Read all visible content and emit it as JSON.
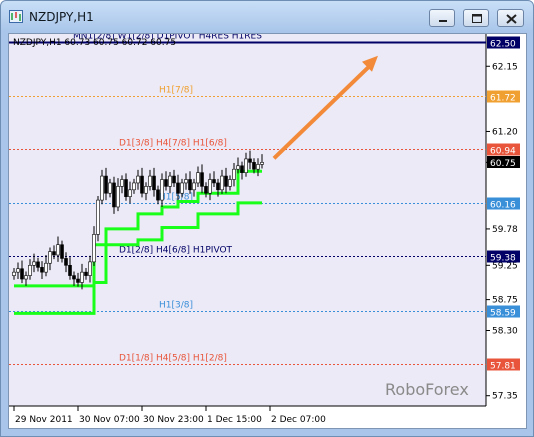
{
  "window": {
    "title": "NZDJPY,H1",
    "buttons": {
      "minimize": "minimize-icon",
      "maximize": "maximize-icon",
      "close": "close-icon"
    }
  },
  "chart_header": "NZDJPY,H1  60.73 60.75 60.72 60.75",
  "watermark": "RoboForex",
  "colors": {
    "background": "#eceaf6",
    "candles": "#000000",
    "trail_line": "#1aff1a",
    "arrow": "#f28a3a",
    "navy": "#000066",
    "orange": "#f0a030",
    "red": "#e8553b",
    "blue": "#3a8fd9"
  },
  "levels": [
    {
      "value": 62.5,
      "label": "MN1[2/8] W1[2/8] D1PIVOT H4RES H1RES",
      "price_tag": "62.50",
      "color": "navy"
    },
    {
      "value": 61.72,
      "label": "H1[7/8]",
      "price_tag": "61.72",
      "color": "orange"
    },
    {
      "value": 60.94,
      "label": "D1[3/8] H4[7/8] H1[6/8]",
      "price_tag": "60.94",
      "color": "red"
    },
    {
      "value": 60.16,
      "label": "H1[5/8]",
      "price_tag": "60.16",
      "color": "blue"
    },
    {
      "value": 59.38,
      "label": "D1[2/8] H4[6/8] H1PIVOT",
      "price_tag": "59.38",
      "color": "navy"
    },
    {
      "value": 58.59,
      "label": "H1[3/8]",
      "price_tag": "58.59",
      "color": "blue"
    },
    {
      "value": 57.81,
      "label": "D1[1/8] H4[5/8] H1[2/8]",
      "price_tag": "57.81",
      "color": "red"
    }
  ],
  "current_price": "60.75",
  "chart_data": {
    "type": "candlestick",
    "ylim": [
      57.2,
      62.62
    ],
    "y_ticks": [
      "62.15",
      "61.20",
      "60.75",
      "59.78",
      "59.25",
      "58.75",
      "58.30",
      "57.35"
    ],
    "y_tick_values": [
      62.15,
      61.2,
      60.75,
      59.78,
      59.25,
      58.75,
      58.3,
      57.35
    ],
    "x_ticks": [
      "29 Nov 2011",
      "30 Nov 07:00",
      "30 Nov 23:00",
      "1 Dec 15:00",
      "2 Dec 07:00"
    ],
    "x_tick_bars": [
      0,
      16,
      32,
      48,
      64
    ],
    "closes": [
      59.15,
      59.2,
      59.05,
      59.1,
      59.25,
      59.3,
      59.22,
      59.15,
      59.28,
      59.45,
      59.4,
      59.55,
      59.35,
      59.25,
      59.1,
      59.05,
      59.0,
      59.15,
      59.1,
      59.3,
      59.7,
      60.2,
      60.55,
      60.3,
      60.45,
      60.1,
      60.4,
      60.5,
      60.25,
      60.35,
      60.45,
      60.55,
      60.3,
      60.4,
      60.55,
      60.35,
      60.2,
      60.5,
      60.4,
      60.55,
      60.45,
      60.3,
      60.45,
      60.5,
      60.35,
      60.45,
      60.6,
      60.4,
      60.3,
      60.5,
      60.45,
      60.35,
      60.55,
      60.4,
      60.5,
      60.65,
      60.7,
      60.6,
      60.8,
      60.75,
      60.65,
      60.72,
      60.75
    ],
    "trailing_stops": [
      {
        "from": 0,
        "to": 20,
        "value": 58.95
      },
      {
        "from": 20,
        "to": 23,
        "value": 59.55
      },
      {
        "from": 23,
        "to": 31,
        "value": 59.78
      },
      {
        "from": 31,
        "to": 37,
        "value": 60.0
      },
      {
        "from": 37,
        "to": 41,
        "value": 60.1
      },
      {
        "from": 41,
        "to": 46,
        "value": 60.18
      },
      {
        "from": 46,
        "to": 56,
        "value": 60.3
      },
      {
        "from": 56,
        "to": 62,
        "value": 60.62
      }
    ],
    "lower_stops": [
      {
        "from": 0,
        "to": 20,
        "value": 58.55
      },
      {
        "from": 20,
        "to": 23,
        "value": 59.0
      },
      {
        "from": 23,
        "to": 31,
        "value": 59.55
      },
      {
        "from": 31,
        "to": 37,
        "value": 59.62
      },
      {
        "from": 37,
        "to": 46,
        "value": 59.8
      },
      {
        "from": 46,
        "to": 56,
        "value": 60.0
      },
      {
        "from": 56,
        "to": 62,
        "value": 60.16
      }
    ],
    "arrow_target": 62.42
  }
}
